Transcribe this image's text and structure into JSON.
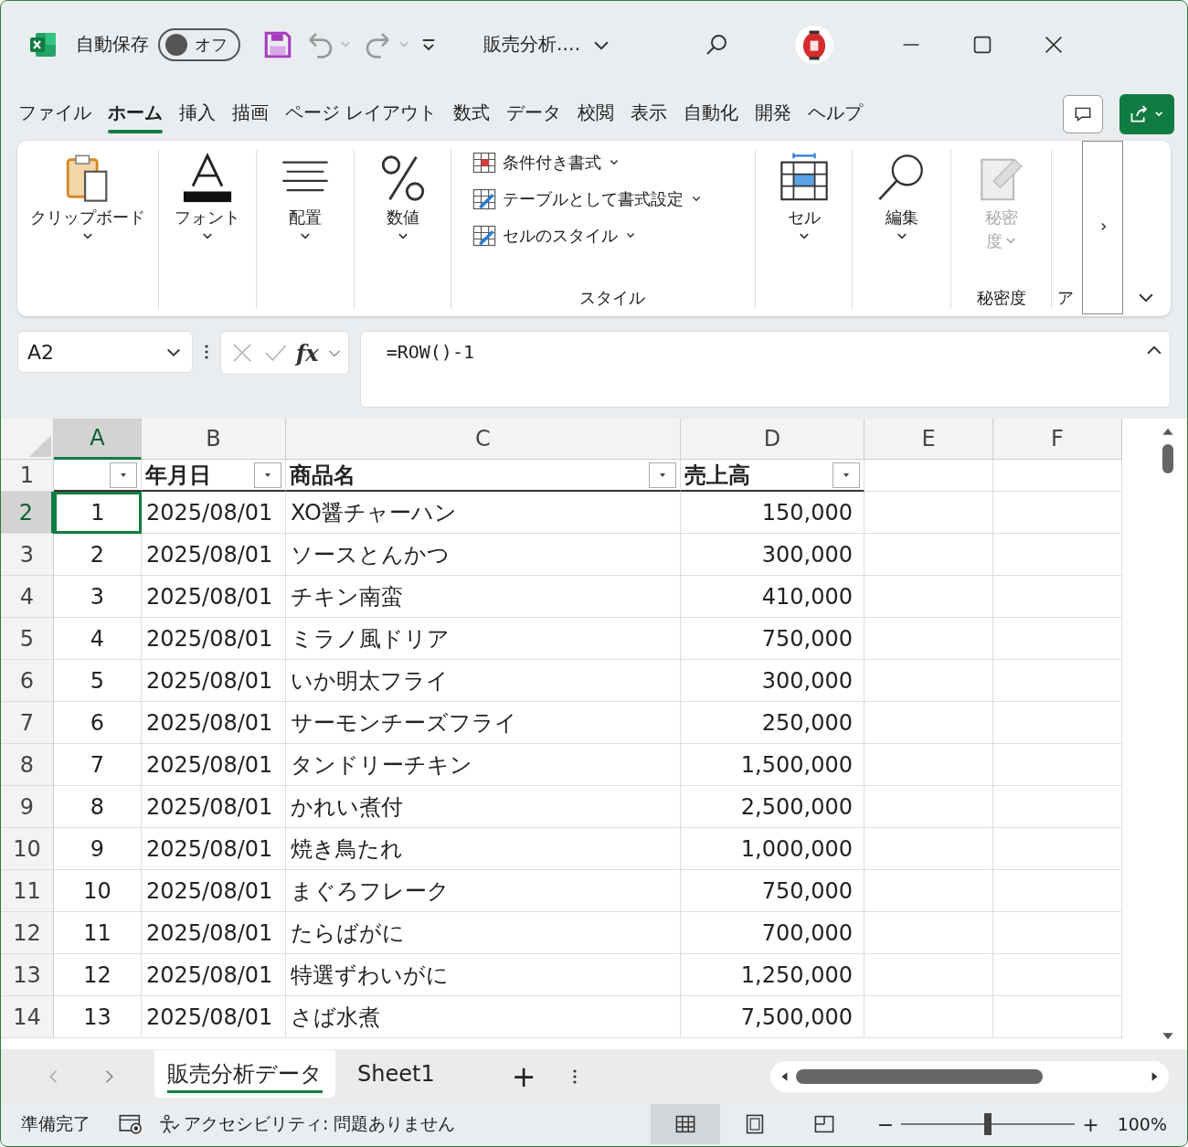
{
  "title_bar": {
    "autosave_label": "自動保存",
    "autosave_toggle": {
      "label": "オフ",
      "on": false
    },
    "file_name": "販売分析.…"
  },
  "tabs": [
    {
      "label": "ファイル",
      "selected": false
    },
    {
      "label": "ホーム",
      "selected": true
    },
    {
      "label": "挿入",
      "selected": false
    },
    {
      "label": "描画",
      "selected": false
    },
    {
      "label": "ページ レイアウト",
      "selected": false
    },
    {
      "label": "数式",
      "selected": false
    },
    {
      "label": "データ",
      "selected": false
    },
    {
      "label": "校閲",
      "selected": false
    },
    {
      "label": "表示",
      "selected": false
    },
    {
      "label": "自動化",
      "selected": false
    },
    {
      "label": "開発",
      "selected": false
    },
    {
      "label": "ヘルプ",
      "selected": false
    }
  ],
  "ribbon": [
    {
      "kind": "clipboard",
      "label": "クリップボード",
      "disabled": false
    },
    {
      "kind": "font",
      "label": "フォント",
      "disabled": false
    },
    {
      "kind": "align",
      "label": "配置",
      "disabled": false
    },
    {
      "kind": "number",
      "label": "数値",
      "disabled": false
    },
    {
      "kind": "styles",
      "group_label": "スタイル",
      "items": [
        "条件付き書式",
        "テーブルとして書式設定",
        "セルのスタイル"
      ]
    },
    {
      "kind": "cells",
      "label": "セル",
      "disabled": false
    },
    {
      "kind": "edit",
      "label": "編集",
      "disabled": false
    },
    {
      "kind": "sensitivity",
      "label": "秘密",
      "label_2": "度",
      "group_label": "秘密度",
      "disabled": true
    },
    {
      "kind": "cut",
      "group_label": "ア"
    }
  ],
  "formula_bar": {
    "name_box": "A2",
    "function_label": "fx",
    "formula": "=ROW()-1"
  },
  "sheet": {
    "columns": [
      {
        "label": "A",
        "selected": true
      },
      {
        "label": "B",
        "selected": false
      },
      {
        "label": "C",
        "selected": false
      },
      {
        "label": "D",
        "selected": false
      },
      {
        "label": "E",
        "selected": false
      },
      {
        "label": "F",
        "selected": false
      }
    ],
    "header_row": {
      "number": "1",
      "cells": [
        "",
        "年月日",
        "商品名",
        "売上高"
      ]
    },
    "rows": [
      {
        "number": "2",
        "selected": true,
        "cells": [
          "1",
          "2025/08/01",
          "XO醤チャーハン",
          "150,000"
        ]
      },
      {
        "number": "3",
        "selected": false,
        "cells": [
          "2",
          "2025/08/01",
          "ソースとんかつ",
          "300,000"
        ]
      },
      {
        "number": "4",
        "selected": false,
        "cells": [
          "3",
          "2025/08/01",
          "チキン南蛮",
          "410,000"
        ]
      },
      {
        "number": "5",
        "selected": false,
        "cells": [
          "4",
          "2025/08/01",
          "ミラノ風ドリア",
          "750,000"
        ]
      },
      {
        "number": "6",
        "selected": false,
        "cells": [
          "5",
          "2025/08/01",
          "いか明太フライ",
          "300,000"
        ]
      },
      {
        "number": "7",
        "selected": false,
        "cells": [
          "6",
          "2025/08/01",
          "サーモンチーズフライ",
          "250,000"
        ]
      },
      {
        "number": "8",
        "selected": false,
        "cells": [
          "7",
          "2025/08/01",
          "タンドリーチキン",
          "1,500,000"
        ]
      },
      {
        "number": "9",
        "selected": false,
        "cells": [
          "8",
          "2025/08/01",
          "かれい煮付",
          "2,500,000"
        ]
      },
      {
        "number": "10",
        "selected": false,
        "cells": [
          "9",
          "2025/08/01",
          "焼き鳥たれ",
          "1,000,000"
        ]
      },
      {
        "number": "11",
        "selected": false,
        "cells": [
          "10",
          "2025/08/01",
          "まぐろフレーク",
          "750,000"
        ]
      },
      {
        "number": "12",
        "selected": false,
        "cells": [
          "11",
          "2025/08/01",
          "たらばがに",
          "700,000"
        ]
      },
      {
        "number": "13",
        "selected": false,
        "cells": [
          "12",
          "2025/08/01",
          "特選ずわいがに",
          "1,250,000"
        ]
      },
      {
        "number": "14",
        "selected": false,
        "cells": [
          "13",
          "2025/08/01",
          "さば水煮",
          "7,500,000"
        ]
      }
    ]
  },
  "sheet_tabs": [
    {
      "label": "販売分析データ",
      "selected": true
    },
    {
      "label": "Sheet1",
      "selected": false
    }
  ],
  "add_sheet": "+",
  "status_bar": {
    "ready": "準備完了",
    "accessibility": "アクセシビリティ: 問題ありません",
    "views": [
      {
        "kind": "normal",
        "selected": true
      },
      {
        "kind": "layout",
        "selected": false
      },
      {
        "kind": "pagebreak",
        "selected": false
      }
    ],
    "zoom_minus": "−",
    "zoom_plus": "+",
    "zoom": {
      "level": 0.5
    },
    "zoom_text": "100%"
  }
}
